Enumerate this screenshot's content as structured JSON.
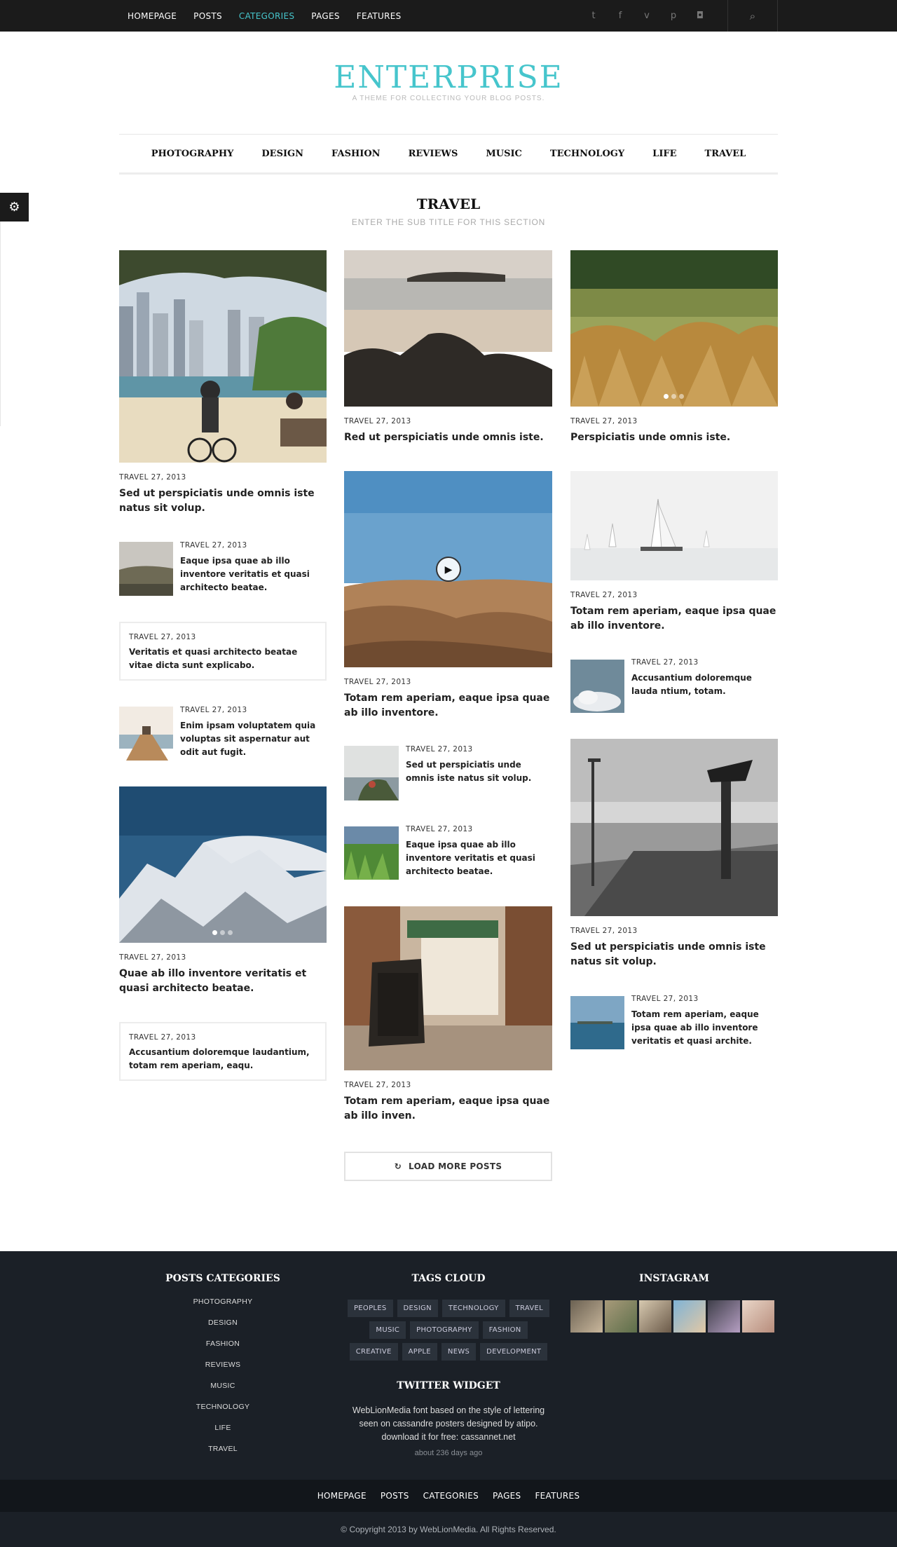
{
  "topnav": {
    "items": [
      "HOMEPAGE",
      "POSTS",
      "CATEGORIES",
      "PAGES",
      "FEATURES"
    ],
    "active": "CATEGORIES",
    "social_icons": [
      "twitter-icon",
      "facebook-icon",
      "vimeo-icon",
      "pinterest-icon",
      "instagram-icon"
    ],
    "search_icon": "search-icon"
  },
  "brand": {
    "logo": "ENTERPRISE",
    "tagline": "A THEME FOR COLLECTING YOUR BLOG POSTS.",
    "accent": "#46c5cc"
  },
  "catnav": [
    "PHOTOGRAPHY",
    "DESIGN",
    "FASHION",
    "REVIEWS",
    "MUSIC",
    "TECHNOLOGY",
    "LIFE",
    "TRAVEL"
  ],
  "section": {
    "title": "TRAVEL",
    "subtitle": "ENTER THE SUB TITLE FOR THIS SECTION"
  },
  "posts": {
    "c1p1": {
      "date": "TRAVEL 27, 2013",
      "title": "Sed ut perspiciatis unde omnis iste natus sit volup."
    },
    "c1p2": {
      "date": "TRAVEL 27, 2013",
      "title": "Eaque ipsa quae ab illo inventore veritatis et quasi architecto beatae."
    },
    "c1p3": {
      "date": "TRAVEL 27, 2013",
      "title": "Veritatis et quasi architecto beatae vitae dicta sunt explicabo."
    },
    "c1p4": {
      "date": "TRAVEL 27, 2013",
      "title": "Enim ipsam voluptatem quia voluptas sit aspernatur aut odit aut fugit."
    },
    "c1p5": {
      "date": "TRAVEL 27, 2013",
      "title": "Quae ab illo inventore veritatis et quasi architecto beatae."
    },
    "c1p6": {
      "date": "TRAVEL 27, 2013",
      "title": "Accusantium doloremque laudantium, totam rem aperiam, eaqu."
    },
    "c2p1": {
      "date": "TRAVEL 27, 2013",
      "title": "Red ut perspiciatis unde omnis iste."
    },
    "c2p2": {
      "date": "TRAVEL 27, 2013",
      "title": "Totam rem aperiam, eaque ipsa quae ab illo inventore."
    },
    "c2p3": {
      "date": "TRAVEL 27, 2013",
      "title": "Sed ut perspiciatis unde omnis iste natus sit volup."
    },
    "c2p4": {
      "date": "TRAVEL 27, 2013",
      "title": "Eaque ipsa quae ab illo inventore veritatis et quasi architecto beatae."
    },
    "c2p5": {
      "date": "TRAVEL 27, 2013",
      "title": "Totam rem aperiam, eaque ipsa quae ab illo inven."
    },
    "c3p1": {
      "date": "TRAVEL 27, 2013",
      "title": "Perspiciatis unde omnis iste."
    },
    "c3p2": {
      "date": "TRAVEL 27, 2013",
      "title": "Totam rem aperiam, eaque ipsa quae ab illo inventore."
    },
    "c3p3": {
      "date": "TRAVEL 27, 2013",
      "title": "Accusantium doloremque lauda ntium, totam."
    },
    "c3p4": {
      "date": "TRAVEL 27, 2013",
      "title": "Sed ut perspiciatis unde omnis iste natus sit volup."
    },
    "c3p5": {
      "date": "TRAVEL 27, 2013",
      "title": "Totam rem aperiam, eaque ipsa quae ab illo inventore veritatis et quasi archite."
    }
  },
  "load_more": "LOAD MORE POSTS",
  "footer": {
    "categories_title": "POSTS CATEGORIES",
    "categories": [
      "PHOTOGRAPHY",
      "DESIGN",
      "FASHION",
      "REVIEWS",
      "MUSIC",
      "TECHNOLOGY",
      "LIFE",
      "TRAVEL"
    ],
    "tags_title": "TAGS CLOUD",
    "tags": [
      "PEOPLES",
      "DESIGN",
      "TECHNOLOGY",
      "TRAVEL",
      "MUSIC",
      "PHOTOGRAPHY",
      "FASHION",
      "CREATIVE",
      "APPLE",
      "NEWS",
      "DEVELOPMENT"
    ],
    "twitter_title": "TWITTER WIDGET",
    "twitter_text": "WebLionMedia font based on the style of lettering seen on cassandre posters designed by atipo. download it for free: cassannet.net",
    "twitter_time": "about 236 days ago",
    "instagram_title": "INSTAGRAM",
    "bottom_nav": [
      "HOMEPAGE",
      "POSTS",
      "CATEGORIES",
      "PAGES",
      "FEATURES"
    ],
    "copyright": "© Copyright 2013 by WebLionMedia. All Rights Reserved."
  }
}
